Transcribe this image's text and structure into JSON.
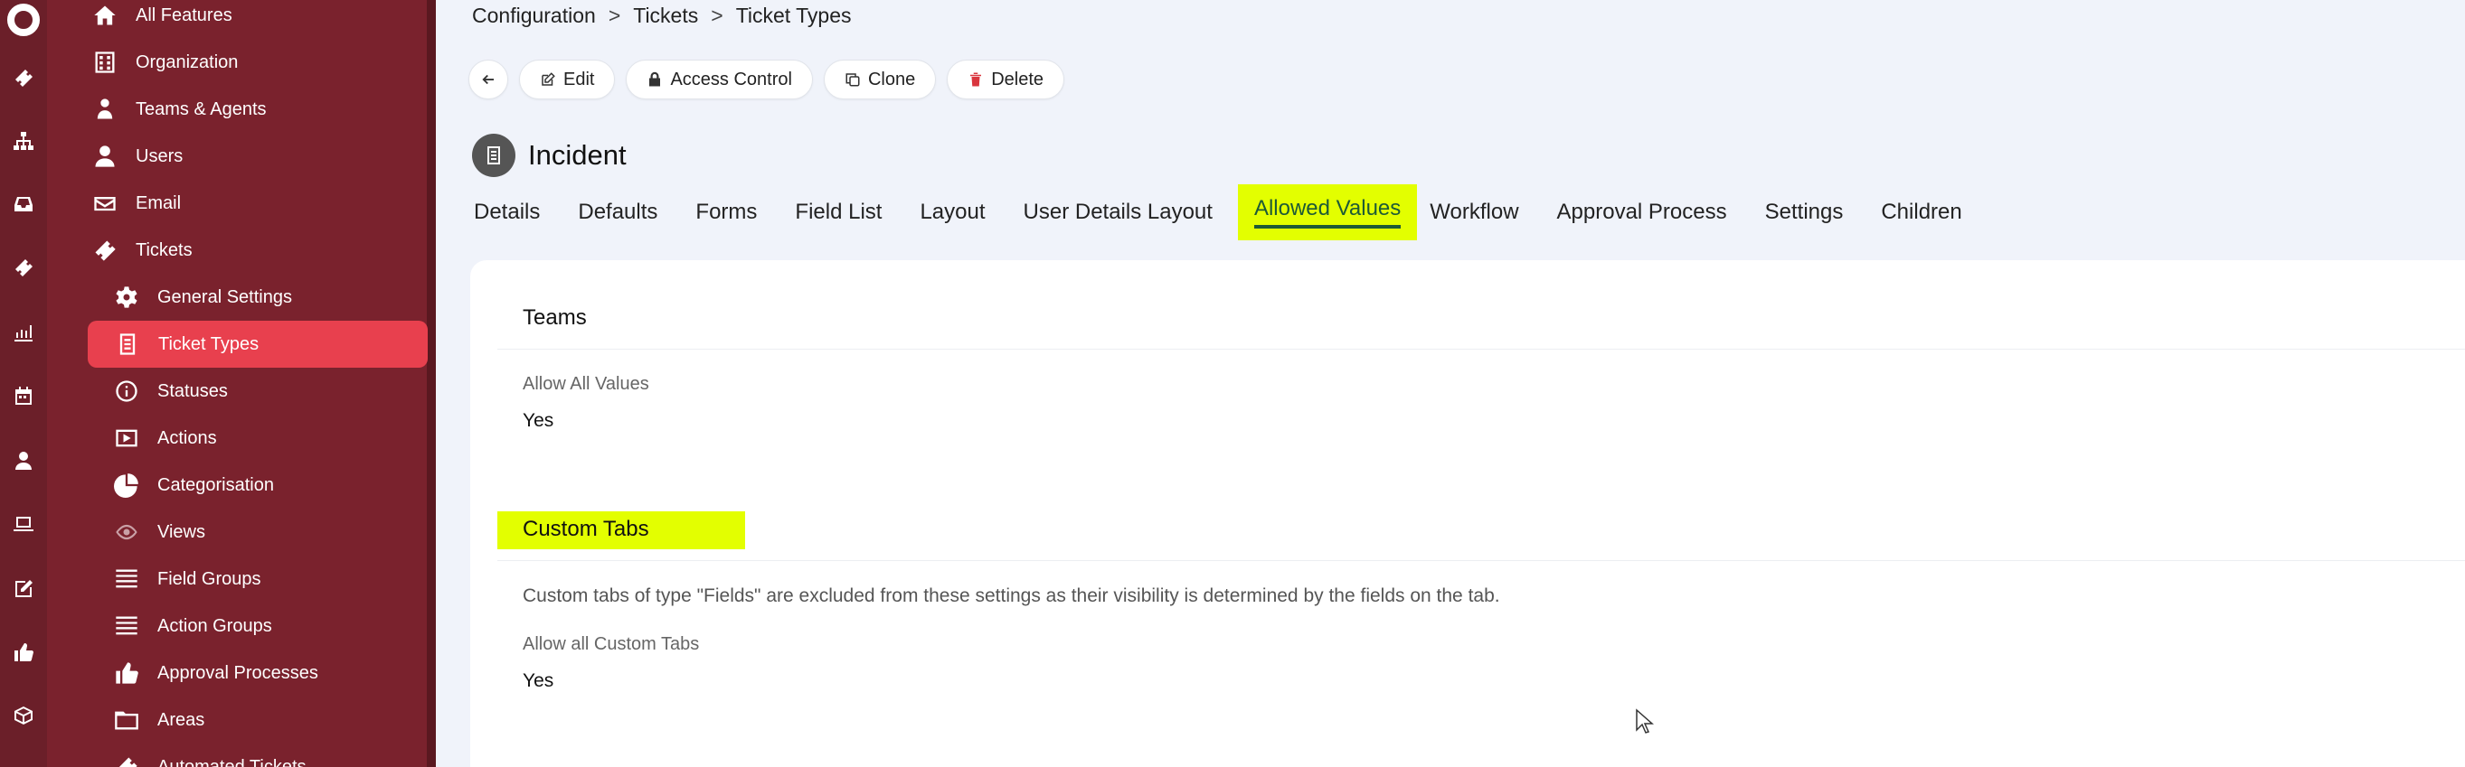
{
  "nav": {
    "items": [
      {
        "label": "All Features",
        "icon": "home-icon"
      },
      {
        "label": "Organization",
        "icon": "building-icon"
      },
      {
        "label": "Teams & Agents",
        "icon": "team-icon"
      },
      {
        "label": "Users",
        "icon": "user-icon"
      },
      {
        "label": "Email",
        "icon": "email-icon"
      },
      {
        "label": "Tickets",
        "icon": "ticket-icon"
      },
      {
        "label": "General Settings",
        "icon": "gear-icon"
      },
      {
        "label": "Ticket Types",
        "icon": "document-icon"
      },
      {
        "label": "Statuses",
        "icon": "info-icon"
      },
      {
        "label": "Actions",
        "icon": "play-icon"
      },
      {
        "label": "Categorisation",
        "icon": "pie-icon"
      },
      {
        "label": "Views",
        "icon": "eye-icon"
      },
      {
        "label": "Field Groups",
        "icon": "list-icon"
      },
      {
        "label": "Action Groups",
        "icon": "list-icon"
      },
      {
        "label": "Approval Processes",
        "icon": "thumbs-up-icon"
      },
      {
        "label": "Areas",
        "icon": "folder-icon"
      },
      {
        "label": "Automated Tickets",
        "icon": "automation-icon"
      }
    ]
  },
  "breadcrumb": {
    "items": [
      "Configuration",
      "Tickets",
      "Ticket Types"
    ],
    "separator": ">"
  },
  "toolbar": {
    "edit": "Edit",
    "access_control": "Access Control",
    "clone": "Clone",
    "delete": "Delete"
  },
  "page": {
    "title": "Incident"
  },
  "tabs": [
    "Details",
    "Defaults",
    "Forms",
    "Field List",
    "Layout",
    "User Details Layout",
    "Allowed Values",
    "Workflow",
    "Approval Process",
    "Settings",
    "Children"
  ],
  "active_tab": "Allowed Values",
  "teams": {
    "title": "Teams",
    "label": "Allow All Values",
    "value": "Yes"
  },
  "custom_tabs": {
    "title": "Custom Tabs",
    "note": "Custom tabs of type \"Fields\" are excluded from these settings as their visibility is determined by the fields on the tab.",
    "label": "Allow all Custom Tabs",
    "value": "Yes"
  },
  "colors": {
    "sidebar": "#7a222d",
    "rail": "#6b1f29",
    "active_nav": "#e8404e",
    "highlight": "#e3ff00",
    "delete": "#d9363e"
  }
}
